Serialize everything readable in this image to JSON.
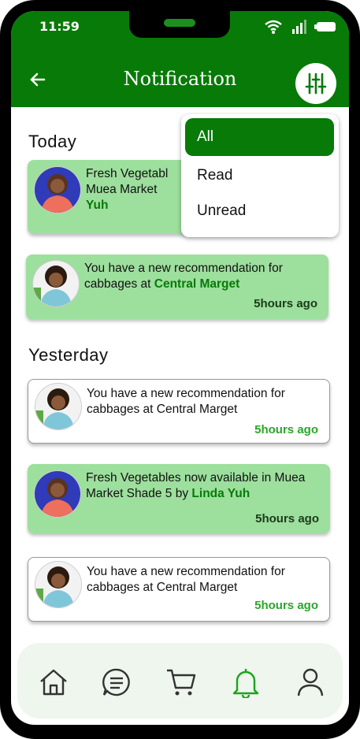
{
  "status_bar": {
    "time": "11:59"
  },
  "header": {
    "title": "Notification"
  },
  "filter_menu": {
    "options": [
      "All",
      "Read",
      "Unread"
    ],
    "selected": "All"
  },
  "sections": {
    "today": "Today",
    "yesterday": "Yesterday"
  },
  "notifications": [
    {
      "state": "unread",
      "text": "Fresh Vegetables now available in Muea Market Shade 5 by ",
      "highlight": "Linda Yuh",
      "time": "5hours ago"
    },
    {
      "state": "unread",
      "text": "You have a new recommendation for cabbages at ",
      "highlight": "Central Marget",
      "time": "5hours ago"
    },
    {
      "state": "read",
      "text": "You have a new recommendation for cabbages at Central Marget",
      "highlight": "",
      "time": "5hours ago"
    },
    {
      "state": "unread",
      "text": "Fresh Vegetables now available in Muea Market Shade 5 by ",
      "highlight": "Linda Yuh",
      "time": "5hours ago"
    },
    {
      "state": "read",
      "text": "You have a new recommendation for cabbages at Central Marget",
      "highlight": "",
      "time": "5hours ago"
    }
  ],
  "card1_visible": {
    "line1": "Fresh Vegetabl",
    "line2": "Muea Market",
    "line3": "Yuh"
  },
  "colors": {
    "brand": "#077a07",
    "unread_bg": "#9ddf9d",
    "read_time": "#2aa52a"
  },
  "nav": {
    "items": [
      "home-icon",
      "messages-icon",
      "cart-icon",
      "bell-icon",
      "user-icon"
    ],
    "active": "bell-icon"
  }
}
